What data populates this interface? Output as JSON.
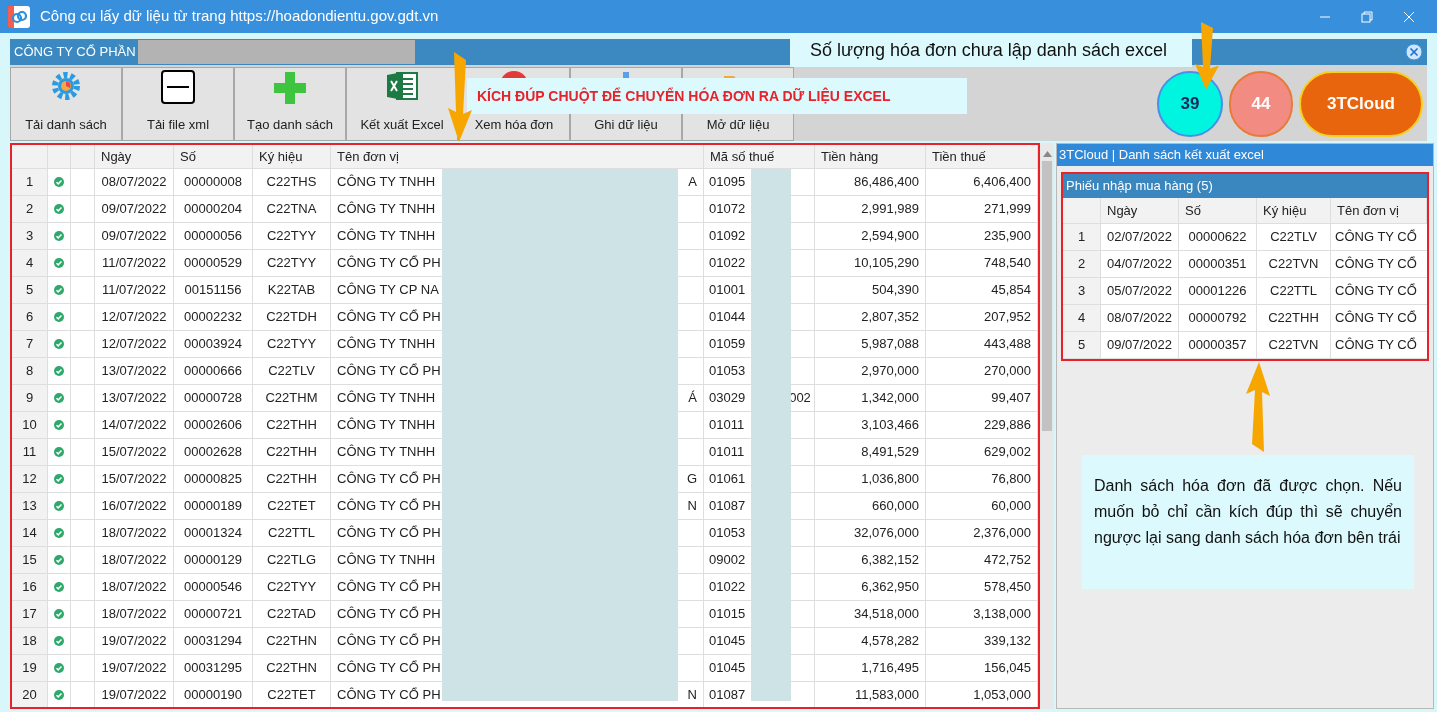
{
  "window": {
    "title": "Công cụ lấy dữ liệu từ trang https://hoadondientu.gov.gdt.vn"
  },
  "company_bar": {
    "title": "CÔNG TY CỔ PHẦN"
  },
  "toolbar": [
    {
      "label": "Tải danh sách",
      "kind": "gear"
    },
    {
      "label": "Tải file xml",
      "kind": "xml"
    },
    {
      "label": "Tạo danh sách",
      "kind": "plus"
    },
    {
      "label": "Kết xuất Excel",
      "kind": "excel"
    },
    {
      "label": "Xem hóa đơn",
      "kind": "view"
    },
    {
      "label": "Ghi dữ liệu",
      "kind": "save"
    },
    {
      "label": "Mở dữ liệu",
      "kind": "open"
    }
  ],
  "counters": [
    {
      "label": "39",
      "color": "#00f5e0"
    },
    {
      "label": "44",
      "color": "#f28b82"
    },
    {
      "label": "3TCloud",
      "color": "#e8650e"
    }
  ],
  "table": {
    "columns": [
      "Ngày",
      "Số",
      "Ký hiệu",
      "Tên đơn vị",
      "Mã số thuế",
      "Tiền hàng",
      "Tiền thuế"
    ],
    "rows": [
      {
        "index": "1",
        "checked": true,
        "date": "08/07/2022",
        "number": "00000008",
        "symbol": "C22THS",
        "name": "CÔNG TY TNHH",
        "name_tail": "A",
        "tax": "01095",
        "tax_tail": "",
        "amount": "86,486,400",
        "vat": "6,406,400"
      },
      {
        "index": "2",
        "checked": true,
        "date": "09/07/2022",
        "number": "00000204",
        "symbol": "C22TNA",
        "name": "CÔNG TY TNHH",
        "name_tail": "",
        "tax": "01072",
        "tax_tail": "",
        "amount": "2,991,989",
        "vat": "271,999"
      },
      {
        "index": "3",
        "checked": true,
        "date": "09/07/2022",
        "number": "00000056",
        "symbol": "C22TYY",
        "name": "CÔNG TY TNHH",
        "name_tail": "",
        "tax": "01092",
        "tax_tail": "",
        "amount": "2,594,900",
        "vat": "235,900"
      },
      {
        "index": "4",
        "checked": true,
        "date": "11/07/2022",
        "number": "00000529",
        "symbol": "C22TYY",
        "name": "CÔNG TY CỔ PH",
        "name_tail": "",
        "tax": "01022",
        "tax_tail": "",
        "amount": "10,105,290",
        "vat": "748,540"
      },
      {
        "index": "5",
        "checked": true,
        "date": "11/07/2022",
        "number": "00151156",
        "symbol": "K22TAB",
        "name": "CÔNG TY CP NA",
        "name_tail": "",
        "tax": "01001",
        "tax_tail": "",
        "amount": "504,390",
        "vat": "45,854"
      },
      {
        "index": "6",
        "checked": true,
        "date": "12/07/2022",
        "number": "00002232",
        "symbol": "C22TDH",
        "name": "CÔNG TY CỔ PH",
        "name_tail": "",
        "tax": "01044",
        "tax_tail": "",
        "amount": "2,807,352",
        "vat": "207,952"
      },
      {
        "index": "7",
        "checked": true,
        "date": "12/07/2022",
        "number": "00003924",
        "symbol": "C22TYY",
        "name": "CÔNG TY TNHH",
        "name_tail": "",
        "tax": "01059",
        "tax_tail": "",
        "amount": "5,987,088",
        "vat": "443,488"
      },
      {
        "index": "8",
        "checked": true,
        "date": "13/07/2022",
        "number": "00000666",
        "symbol": "C22TLV",
        "name": "CÔNG TY CỔ PH",
        "name_tail": "",
        "tax": "01053",
        "tax_tail": "",
        "amount": "2,970,000",
        "vat": "270,000"
      },
      {
        "index": "9",
        "checked": true,
        "date": "13/07/2022",
        "number": "00000728",
        "symbol": "C22THM",
        "name": "CÔNG TY TNHH",
        "name_tail": "Á",
        "tax": "03029",
        "tax_tail": "002",
        "amount": "1,342,000",
        "vat": "99,407"
      },
      {
        "index": "10",
        "checked": true,
        "date": "14/07/2022",
        "number": "00002606",
        "symbol": "C22THH",
        "name": "CÔNG TY TNHH",
        "name_tail": "",
        "tax": "01011",
        "tax_tail": "",
        "amount": "3,103,466",
        "vat": "229,886"
      },
      {
        "index": "11",
        "checked": true,
        "date": "15/07/2022",
        "number": "00002628",
        "symbol": "C22THH",
        "name": "CÔNG TY TNHH",
        "name_tail": "",
        "tax": "01011",
        "tax_tail": "",
        "amount": "8,491,529",
        "vat": "629,002"
      },
      {
        "index": "12",
        "checked": true,
        "date": "15/07/2022",
        "number": "00000825",
        "symbol": "C22THH",
        "name": "CÔNG TY CỔ PH",
        "name_tail": "G",
        "tax": "01061",
        "tax_tail": "",
        "amount": "1,036,800",
        "vat": "76,800"
      },
      {
        "index": "13",
        "checked": true,
        "date": "16/07/2022",
        "number": "00000189",
        "symbol": "C22TET",
        "name": "CÔNG TY CỔ PH",
        "name_tail": "N",
        "tax": "01087",
        "tax_tail": "",
        "amount": "660,000",
        "vat": "60,000"
      },
      {
        "index": "14",
        "checked": true,
        "date": "18/07/2022",
        "number": "00001324",
        "symbol": "C22TTL",
        "name": "CÔNG TY CỔ PH",
        "name_tail": "",
        "tax": "01053",
        "tax_tail": "",
        "amount": "32,076,000",
        "vat": "2,376,000"
      },
      {
        "index": "15",
        "checked": true,
        "date": "18/07/2022",
        "number": "00000129",
        "symbol": "C22TLG",
        "name": "CÔNG TY TNHH",
        "name_tail": "",
        "tax": "09002",
        "tax_tail": "",
        "amount": "6,382,152",
        "vat": "472,752"
      },
      {
        "index": "16",
        "checked": true,
        "date": "18/07/2022",
        "number": "00000546",
        "symbol": "C22TYY",
        "name": "CÔNG TY CỔ PH",
        "name_tail": "",
        "tax": "01022",
        "tax_tail": "",
        "amount": "6,362,950",
        "vat": "578,450"
      },
      {
        "index": "17",
        "checked": true,
        "date": "18/07/2022",
        "number": "00000721",
        "symbol": "C22TAD",
        "name": "CÔNG TY CỔ PH",
        "name_tail": "",
        "tax": "01015",
        "tax_tail": "",
        "amount": "34,518,000",
        "vat": "3,138,000"
      },
      {
        "index": "18",
        "checked": true,
        "date": "19/07/2022",
        "number": "00031294",
        "symbol": "C22THN",
        "name": "CÔNG TY CỔ PH",
        "name_tail": "",
        "tax": "01045",
        "tax_tail": "",
        "amount": "4,578,282",
        "vat": "339,132"
      },
      {
        "index": "19",
        "checked": true,
        "date": "19/07/2022",
        "number": "00031295",
        "symbol": "C22THN",
        "name": "CÔNG TY CỔ PH",
        "name_tail": "",
        "tax": "01045",
        "tax_tail": "",
        "amount": "1,716,495",
        "vat": "156,045"
      },
      {
        "index": "20",
        "checked": true,
        "date": "19/07/2022",
        "number": "00000190",
        "symbol": "C22TET",
        "name": "CÔNG TY CỔ PH",
        "name_tail": "N",
        "tax": "01087",
        "tax_tail": "",
        "amount": "11,583,000",
        "vat": "1,053,000"
      }
    ]
  },
  "side_panel": {
    "title": "3TCloud | Danh sách kết xuất excel",
    "group_title": "Phiếu nhập mua hàng (5)",
    "columns": [
      "Ngày",
      "Số",
      "Ký hiệu",
      "Tên đơn vị"
    ],
    "rows": [
      {
        "index": "1",
        "date": "02/07/2022",
        "number": "00000622",
        "symbol": "C22TLV",
        "name": "CÔNG TY CỔ"
      },
      {
        "index": "2",
        "date": "04/07/2022",
        "number": "00000351",
        "symbol": "C22TVN",
        "name": "CÔNG TY CỔ"
      },
      {
        "index": "3",
        "date": "05/07/2022",
        "number": "00001226",
        "symbol": "C22TTL",
        "name": "CÔNG TY CỔ"
      },
      {
        "index": "4",
        "date": "08/07/2022",
        "number": "00000792",
        "symbol": "C22THH",
        "name": "CÔNG TY CỔ"
      },
      {
        "index": "5",
        "date": "09/07/2022",
        "number": "00000357",
        "symbol": "C22TVN",
        "name": "CÔNG TY CỔ"
      }
    ]
  },
  "annotations": {
    "double_click_hint": "KÍCH ĐÚP CHUỘT ĐỂ CHUYỂN HÓA ĐƠN RA DỮ LIỆU EXCEL",
    "count_hint": "Số lượng hóa đơn chưa lập danh sách excel",
    "selected_hint": "Danh sách hóa đơn đã được chọn. Nếu muốn bỏ chỉ cần kích đúp thì sẽ chuyển ngược lại sang danh sách hóa đơn bên trái"
  }
}
